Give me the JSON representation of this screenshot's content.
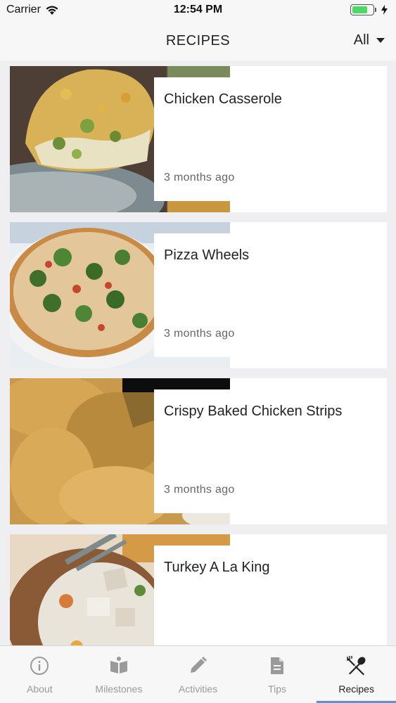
{
  "status": {
    "carrier": "Carrier",
    "time": "12:54 PM",
    "battery_level": 0.75,
    "battery_color": "#4cd964"
  },
  "header": {
    "title": "RECIPES",
    "filter_label": "All",
    "filter_icon": "chevron-down-icon"
  },
  "recipes": [
    {
      "title": "Chicken Casserole",
      "time": "3 months ago",
      "image": "casserole-photo"
    },
    {
      "title": "Pizza Wheels",
      "time": "3 months ago",
      "image": "pizza-photo"
    },
    {
      "title": "Crispy Baked Chicken Strips",
      "time": "3 months ago",
      "image": "chicken-strips-photo"
    },
    {
      "title": "Turkey A La King",
      "time": "",
      "image": "turkey-photo"
    }
  ],
  "tabs": [
    {
      "label": "About",
      "icon": "info-icon"
    },
    {
      "label": "Milestones",
      "icon": "book-icon"
    },
    {
      "label": "Activities",
      "icon": "pencil-icon"
    },
    {
      "label": "Tips",
      "icon": "document-icon"
    },
    {
      "label": "Recipes",
      "icon": "utensils-icon",
      "active": true
    }
  ],
  "colors": {
    "active_tab_indicator": "#5b8fd6",
    "inactive_tab": "#9a9a9a"
  }
}
